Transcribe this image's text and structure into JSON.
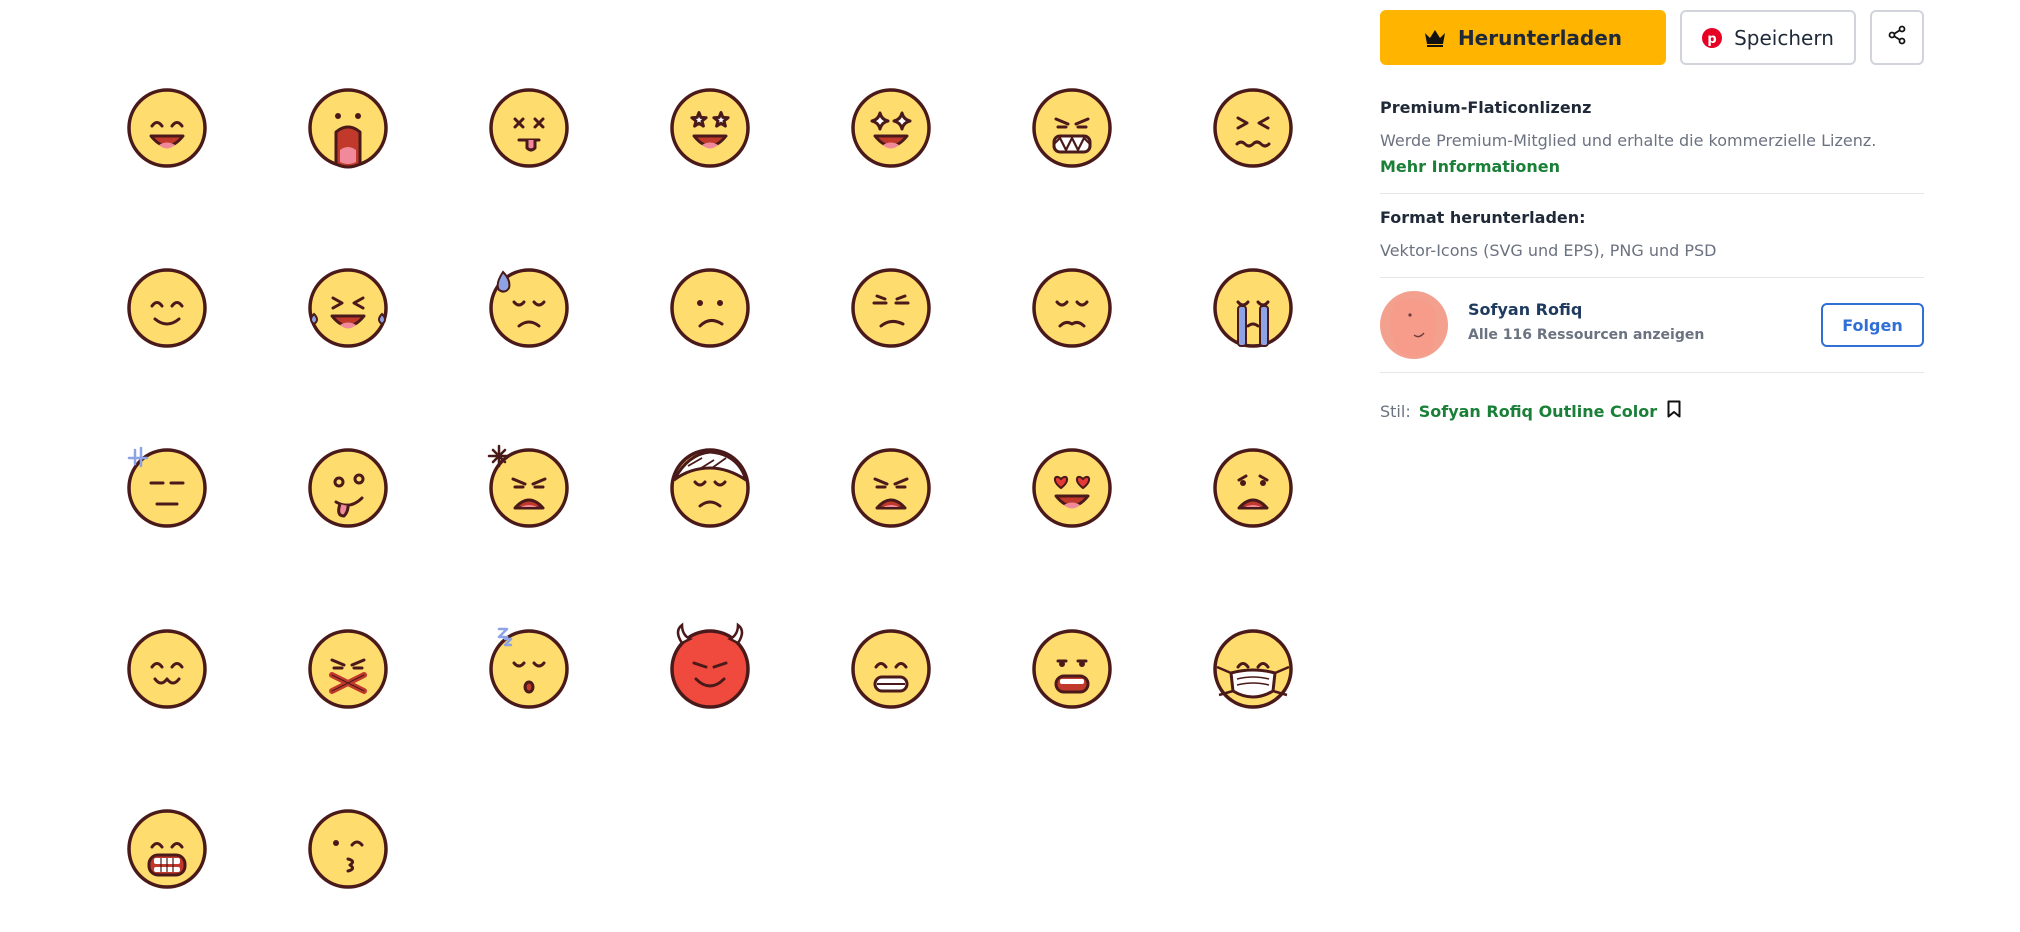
{
  "emoji_grid": {
    "items": [
      {
        "name": "grinning-face-icon",
        "face": "#FFDC6E"
      },
      {
        "name": "screaming-face-icon",
        "face": "#FFDC6E"
      },
      {
        "name": "dizzy-face-tongue-icon",
        "face": "#FFDC6E"
      },
      {
        "name": "star-struck-face-icon",
        "face": "#FFDC6E"
      },
      {
        "name": "sparkle-eyes-face-icon",
        "face": "#FFDC6E"
      },
      {
        "name": "angry-grimace-face-icon",
        "face": "#FFDC6E"
      },
      {
        "name": "confounded-face-icon",
        "face": "#FFDC6E"
      },
      {
        "name": "smiling-face-icon",
        "face": "#FFDC6E"
      },
      {
        "name": "tears-of-joy-face-icon",
        "face": "#FFDC6E"
      },
      {
        "name": "sweat-sad-face-icon",
        "face": "#FFDC6E"
      },
      {
        "name": "confused-face-icon",
        "face": "#FFDC6E"
      },
      {
        "name": "unamused-face-icon",
        "face": "#FFDC6E"
      },
      {
        "name": "pensive-face-icon",
        "face": "#FFDC6E"
      },
      {
        "name": "crying-face-icon",
        "face": "#FFDC6E"
      },
      {
        "name": "expressionless-face-icon",
        "face": "#FFDC6E"
      },
      {
        "name": "goofy-tongue-face-icon",
        "face": "#FFDC6E"
      },
      {
        "name": "annoyed-shouting-face-icon",
        "face": "#FFDC6E"
      },
      {
        "name": "bandaged-face-icon",
        "face": "#FFDC6E"
      },
      {
        "name": "frowning-open-mouth-face-icon",
        "face": "#FFDC6E"
      },
      {
        "name": "heart-eyes-face-icon",
        "face": "#FFDC6E"
      },
      {
        "name": "anguished-face-icon",
        "face": "#FFDC6E"
      },
      {
        "name": "cat-smile-face-icon",
        "face": "#FFDC6E"
      },
      {
        "name": "sealed-mouth-face-icon",
        "face": "#FFDC6E"
      },
      {
        "name": "sleeping-face-icon",
        "face": "#FFDC6E"
      },
      {
        "name": "devil-face-icon",
        "face": "#F0493E"
      },
      {
        "name": "grimacing-face-icon",
        "face": "#FFDC6E"
      },
      {
        "name": "grinning-teeth-face-icon",
        "face": "#FFDC6E"
      },
      {
        "name": "face-mask-icon",
        "face": "#FFDC6E"
      },
      {
        "name": "shouting-teeth-face-icon",
        "face": "#FFDC6E"
      },
      {
        "name": "kissing-face-icon",
        "face": "#FFDC6E"
      }
    ]
  },
  "actions": {
    "download_label": "Herunterladen",
    "save_label": "Speichern",
    "download_icon": "crown-icon",
    "save_icon": "pinterest-icon",
    "share_icon": "share-icon"
  },
  "license": {
    "title": "Premium-Flaticonlizenz",
    "text": "Werde Premium-Mitglied und erhalte die kommerzielle Lizenz.",
    "link": "Mehr Informationen"
  },
  "format": {
    "title": "Format herunterladen:",
    "text": "Vektor-Icons (SVG und EPS), PNG und PSD"
  },
  "author": {
    "name": "Sofyan Rofiq",
    "resources": "Alle 116 Ressourcen anzeigen",
    "follow_label": "Folgen"
  },
  "style": {
    "label": "Stil:",
    "name": "Sofyan Rofiq Outline Color",
    "bookmark_icon": "bookmark-icon"
  },
  "colors": {
    "accent": "#FFB400",
    "link_green": "#1a7f37",
    "follow_blue": "#2f6fd6",
    "outline": "#4a1a1a",
    "mouth": "#C0392B",
    "tongue": "#F08A9A",
    "tears": "#8EA3E6",
    "pinterest": "#E60023"
  }
}
